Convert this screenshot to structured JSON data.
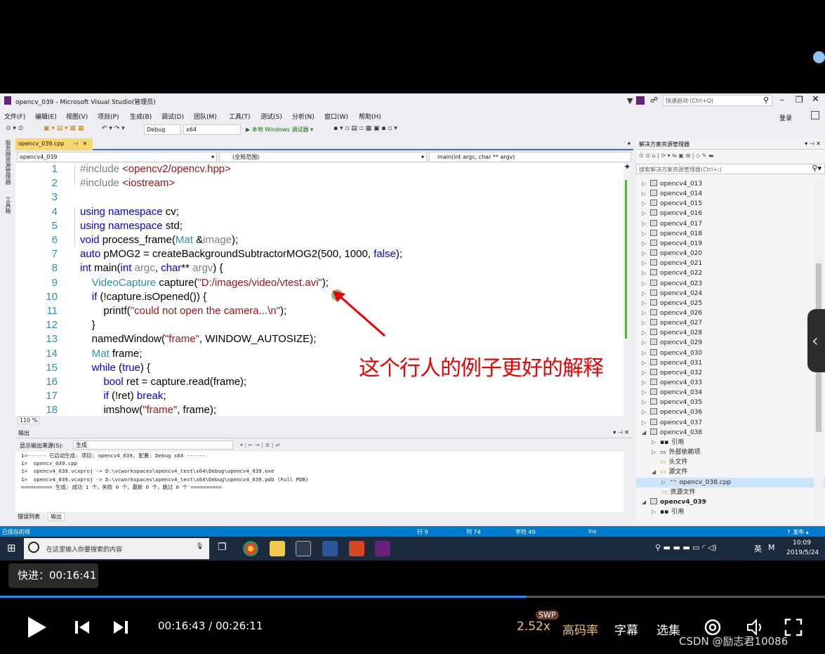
{
  "vs": {
    "title": "opencv_039 - Microsoft Visual Studio(管理员)",
    "quick_launch": "快速启动 (Ctrl+Q)",
    "login": "登录",
    "menu": [
      "文件(F)",
      "编辑(E)",
      "视图(V)",
      "项目(P)",
      "生成(B)",
      "调试(D)",
      "团队(M)",
      "工具(T)",
      "测试(S)",
      "分析(N)",
      "窗口(W)",
      "帮助(H)"
    ],
    "config": "Debug",
    "platform": "x64",
    "run_label": "▶ 本地 Windows 调试器 ▾",
    "left_strip_1": "服务器资源管理器",
    "left_strip_2": "工具箱"
  },
  "editor": {
    "tab": "opencv_039.cpp",
    "project_dropdown": "opencv4_039",
    "scope_dropdown": "(全局范围)",
    "function_dropdown": "main(int argc, char ** argv)",
    "zoom": "110 %",
    "line_numbers": [
      "1",
      "2",
      "3",
      "4",
      "5",
      "6",
      "7",
      "8",
      "9",
      "10",
      "11",
      "12",
      "13",
      "14",
      "15",
      "16",
      "17",
      "18"
    ]
  },
  "output": {
    "title": "输出",
    "source_label": "显示输出来源(S):",
    "source_value": "生成",
    "lines": [
      "1>------ 已启动生成: 项目: opencv4_039, 配置: Debug x64 ------",
      "1>  opencv_039.cpp",
      "1>  opencv4_039.vcxproj -> D:\\vcworkspaces\\opencv4_test\\x64\\Debug\\opencv4_039.exe",
      "1>  opencv4_039.vcxproj -> D:\\vcworkspaces\\opencv4_test\\x64\\Debug\\opencv4_039.pdb (Full PDB)",
      "========== 生成: 成功 1 个，失败 0 个，最新 0 个，跳过 0 个 =========="
    ],
    "tab_errors": "错误列表",
    "tab_output": "输出"
  },
  "solution_explorer": {
    "title": "解决方案资源管理器",
    "search_placeholder": "搜索解决方案资源管理器(Ctrl+;)",
    "projects": [
      "opencv4_013",
      "opencv4_014",
      "opencv4_015",
      "opencv4_016",
      "opencv4_017",
      "opencv4_018",
      "opencv4_019",
      "opencv4_020",
      "opencv4_021",
      "opencv4_022",
      "opencv4_023",
      "opencv4_024",
      "opencv4_025",
      "opencv4_026",
      "opencv4_027",
      "opencv4_028",
      "opencv4_029",
      "opencv4_030",
      "opencv4_031",
      "opencv4_032",
      "opencv4_033",
      "opencv4_034",
      "opencv4_035",
      "opencv4_036",
      "opencv4_037",
      "opencv4_038"
    ],
    "children": [
      "引用",
      "外部依赖项",
      "头文件",
      "源文件"
    ],
    "file": "opencv_038.cpp",
    "resource": "资源文件",
    "project_039": "opencv4_039",
    "ref2": "引用"
  },
  "status": {
    "saved": "已保存的项",
    "row": "行 9",
    "col": "列 74",
    "char": "字符 49",
    "ins": "Ins",
    "publish": "↑ 发布 ▴"
  },
  "taskbar": {
    "search": "在这里输入你要搜索的内容",
    "lang": "英",
    "time": "10:09",
    "date": "2019/5/24"
  },
  "annotation": "这个行人的例子更好的解释",
  "player": {
    "fastforward": "快进：00:16:41",
    "time": "00:16:43 / 00:26:11",
    "progress": 0.638,
    "speed": "2.52x",
    "swp": "SWP",
    "quality": "高码率",
    "subtitle": "字幕",
    "episodes": "选集",
    "watermark": "CSDN @励志君10086"
  }
}
